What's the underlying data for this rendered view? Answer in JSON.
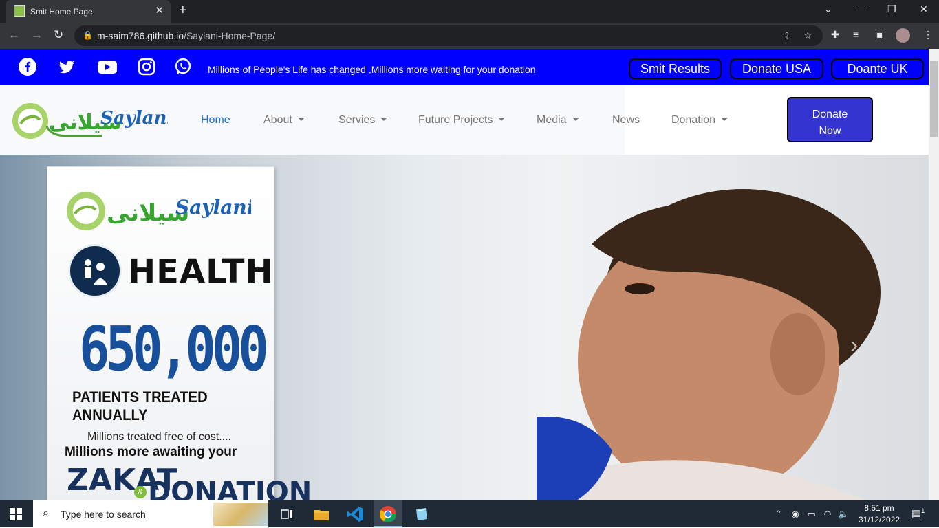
{
  "browser": {
    "tab_title": "Smit Home Page",
    "url_host": "m-saim786.github.io",
    "url_path": "/Saylani-Home-Page/"
  },
  "topbar": {
    "tagline": "Millions of People's Life has changed ,Millions more waiting for your donation",
    "buttons": [
      "Smit Results",
      "Donate USA",
      "Doante UK"
    ]
  },
  "nav": {
    "brand": "Saylani",
    "brand_urdu": "سیلانی",
    "links": [
      "Home",
      "About",
      "Servies",
      "Future Projects",
      "Media",
      "News",
      "Donation"
    ],
    "donate_btn": [
      "Donate",
      "Now"
    ]
  },
  "hero": {
    "brand": "Saylani",
    "health": "HEALTH",
    "number": "650,000",
    "patients": "PATIENTS TREATED ANNUALLY",
    "millions1": "Millions treated free of cost....",
    "millions2": "Millions more awaiting your",
    "zakat": "ZAKAT",
    "amp": "&",
    "donation": "DONATION"
  },
  "taskbar": {
    "search_placeholder": "Type here to search",
    "time": "8:51 pm",
    "date": "31/12/2022",
    "notification_count": "1"
  },
  "colors": {
    "topbar_bg": "#0000fe",
    "donate_now_bg": "#3434d0",
    "active_link": "#1e6bd6"
  }
}
